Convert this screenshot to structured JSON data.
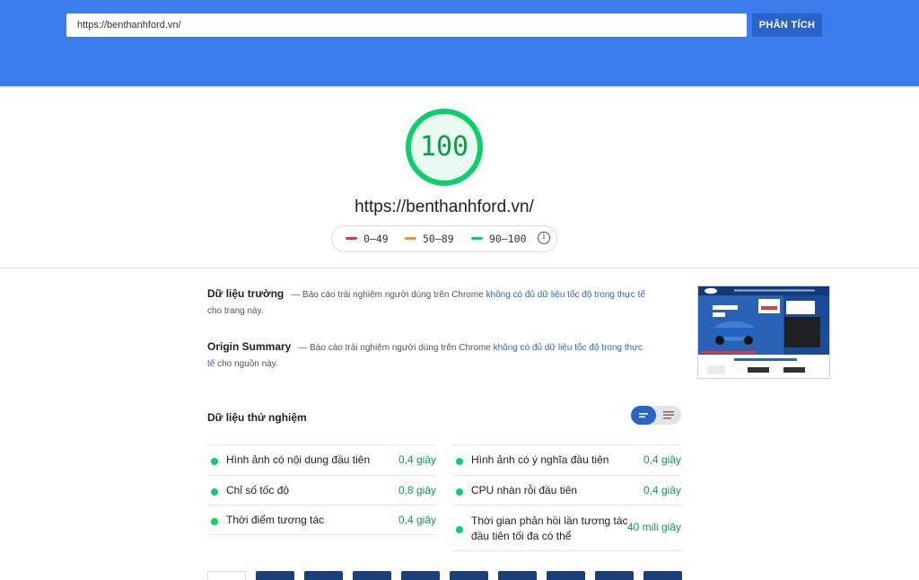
{
  "header": {
    "url_value": "https://benthanhford.vn/",
    "analyze_label": "PHÂN TÍCH"
  },
  "score": {
    "value": "100",
    "color": "#0cce6b"
  },
  "page_url": "https://benthanhford.vn/",
  "legend": [
    {
      "range": "0–49",
      "color": "#e03b3b"
    },
    {
      "range": "50–89",
      "color": "#f2943d"
    },
    {
      "range": "90–100",
      "color": "#0cce6b"
    }
  ],
  "field_data": {
    "title": "Dữ liệu trường",
    "text": "— Báo cáo trải nghiệm người dùng trên Chrome ",
    "link": "không có đủ dữ liệu tốc độ trong thực tế",
    "tail": " cho trang này."
  },
  "origin_summary": {
    "title": "Origin Summary",
    "text": "— Báo cáo trải nghiệm người dùng trên Chrome ",
    "link": "không có đủ dữ liệu tốc độ trong thực tế",
    "tail": " cho nguồn này."
  },
  "lab_data": {
    "title": "Dữ liệu thử nghiệm",
    "metrics_left": [
      {
        "name": "Hình ảnh có nội dung đầu tiên",
        "value": "0,4 giây"
      },
      {
        "name": "Chỉ số tốc độ",
        "value": "0,8 giây"
      },
      {
        "name": "Thời điểm tương tác",
        "value": "0,4 giây"
      }
    ],
    "metrics_right": [
      {
        "name": "Hình ảnh có ý nghĩa đầu tiên",
        "value": "0,4 giây"
      },
      {
        "name": "CPU nhàn rỗi đầu tiên",
        "value": "0,4 giây"
      },
      {
        "name": "Thời gian phản hồi lần tương tác đầu tiên tối đa có thể",
        "value": "40 mili giây"
      }
    ]
  }
}
